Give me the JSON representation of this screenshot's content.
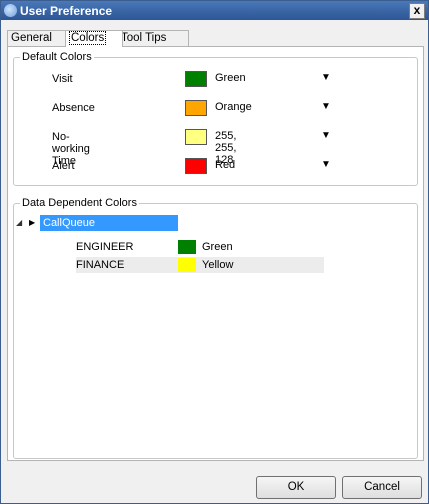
{
  "window": {
    "title": "User Preference",
    "close_label": "x"
  },
  "tabs": [
    {
      "label": "General",
      "active": false
    },
    {
      "label": "Colors",
      "active": true
    },
    {
      "label": "Tool Tips",
      "active": false
    }
  ],
  "default_colors": {
    "legend": "Default Colors",
    "rows": [
      {
        "label": "Visit",
        "value": "Green",
        "color": "#008000"
      },
      {
        "label": "Absence",
        "value": "Orange",
        "color": "#ffa500"
      },
      {
        "label": "No-working Time",
        "value": "255, 255, 128",
        "color": "#ffff80"
      },
      {
        "label": "Alert",
        "value": "Red",
        "color": "#ff0000"
      }
    ]
  },
  "data_dependent": {
    "legend": "Data Dependent Colors",
    "root": "CallQueue",
    "children": [
      {
        "name": "ENGINEER",
        "value": "Green",
        "color": "#008000"
      },
      {
        "name": "FINANCE",
        "value": "Yellow",
        "color": "#ffff00"
      }
    ]
  },
  "buttons": {
    "ok": "OK",
    "cancel": "Cancel"
  }
}
